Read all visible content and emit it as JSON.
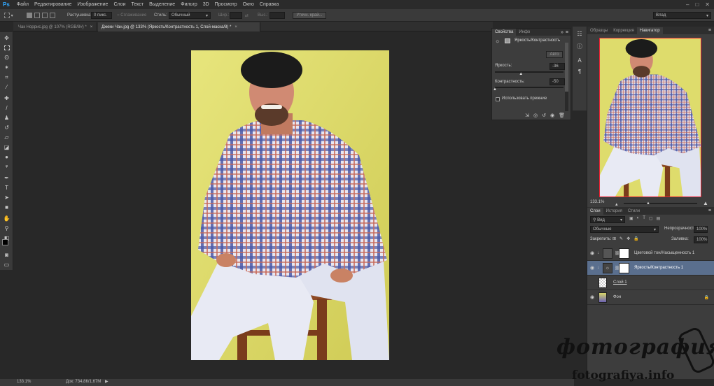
{
  "menubar": {
    "logo": "Ps",
    "items": [
      "Файл",
      "Редактирование",
      "Изображение",
      "Слои",
      "Текст",
      "Выделение",
      "Фильтр",
      "3D",
      "Просмотр",
      "Окно",
      "Справка"
    ],
    "win_min": "–",
    "win_max": "□",
    "win_close": "✕"
  },
  "options": {
    "feather_label": "Растушевка:",
    "feather_value": "0 пикс.",
    "antialias_label": "Сглаживание",
    "style_label": "Стиль:",
    "style_value": "Обычный",
    "width_label": "Шир.:",
    "height_label": "Выс.:",
    "refine_button": "Уточн. край...",
    "workspace_value": "Влад"
  },
  "doc_tabs": [
    {
      "label": "Чак Норрис.jpg @ 107% (RGB/8#) *"
    },
    {
      "label": "Джеки Чан.jpg @ 133% (Яркость/Контрастность 1, Слой-маска/8) *"
    }
  ],
  "status": {
    "zoom": "133.1%",
    "doc_info": "Док: 734,8К/1,67М"
  },
  "properties": {
    "tabs": [
      "Свойства",
      "Инфо"
    ],
    "collapse": "»",
    "menu": "≡",
    "title": "Яркость/Контрастность",
    "auto_button": "Авто",
    "brightness_label": "Яркость:",
    "brightness_value": "-36",
    "brightness_level": -36,
    "contrast_label": "Контрастность:",
    "contrast_value": "-50",
    "contrast_level": -50,
    "legacy_label": "Использовать прежние"
  },
  "right_panel_tabs": [
    "Образцы",
    "Коррекция",
    "Навигатор"
  ],
  "navigator": {
    "zoom": "133.1%"
  },
  "layers_panel": {
    "tabs": [
      "Слои",
      "История",
      "Стили"
    ],
    "filter_value": "Вид",
    "blend_mode": "Обычные",
    "opacity_label": "Непрозрачность:",
    "opacity_value": "100%",
    "lock_label": "Закрепить:",
    "fill_label": "Заливка:",
    "fill_value": "100%",
    "layers": [
      {
        "name": "Цветовой тон/Насыщенность 1",
        "selected": false
      },
      {
        "name": "Яркость/Контрастность 1",
        "selected": true
      },
      {
        "name": "Слой 1",
        "selected": false
      },
      {
        "name": "Фон",
        "selected": false
      }
    ]
  },
  "watermark": {
    "title": "фотография",
    "url": "fotografiya.info"
  },
  "colors": {
    "accent": "#31a8ff",
    "selected_layer": "#5a6f8e",
    "canvas_bg": "#282828",
    "photo_bg": "#d9d769"
  }
}
